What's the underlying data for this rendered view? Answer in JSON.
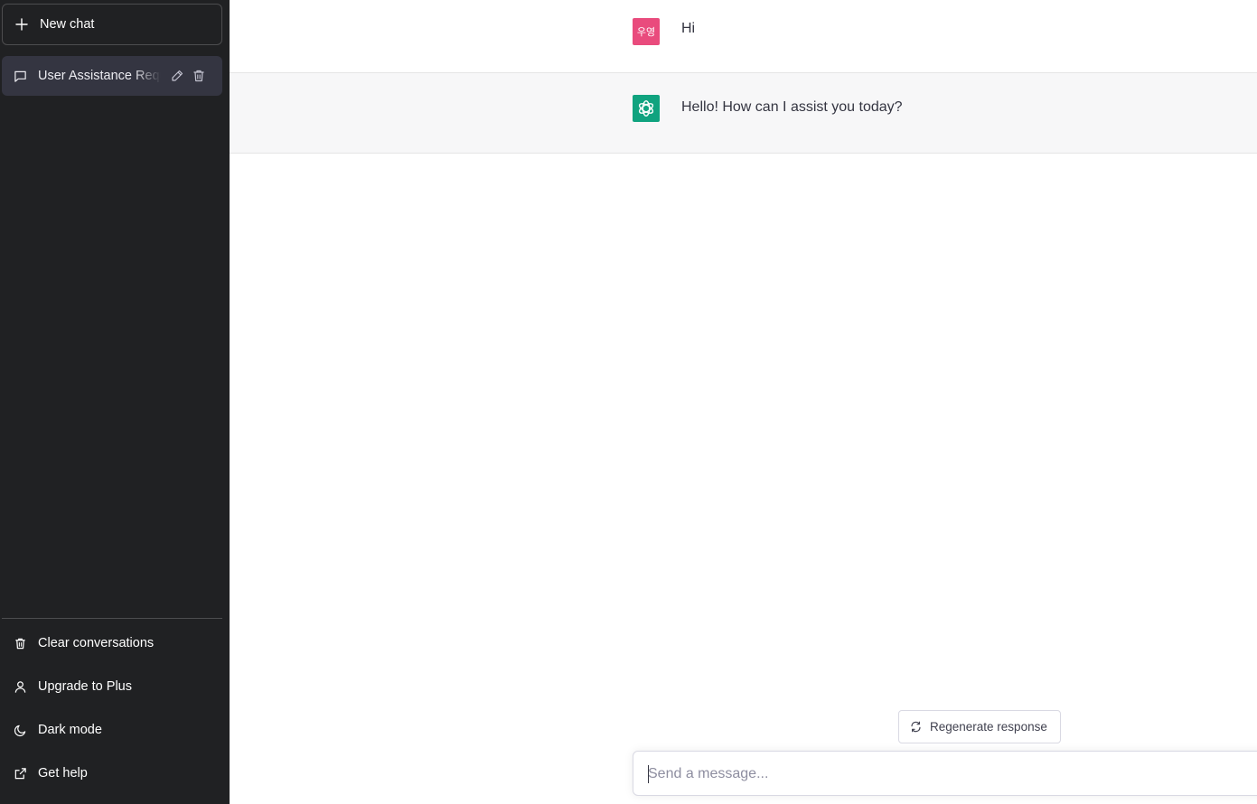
{
  "sidebar": {
    "new_chat_label": "New chat",
    "conversations": [
      {
        "title": "User Assistance Requ"
      }
    ],
    "menu": [
      {
        "label": "Clear conversations",
        "icon": "trash-icon"
      },
      {
        "label": "Upgrade to Plus",
        "icon": "user-icon"
      },
      {
        "label": "Dark mode",
        "icon": "moon-icon"
      },
      {
        "label": "Get help",
        "icon": "external-link-icon"
      }
    ]
  },
  "chat": {
    "messages": [
      {
        "role": "user",
        "avatar_text": "우영",
        "text": "Hi"
      },
      {
        "role": "assistant",
        "avatar_icon": "openai-logo-icon",
        "text": "Hello! How can I assist you today?"
      }
    ],
    "regenerate_label": "Regenerate response",
    "input_placeholder": "Send a message..."
  },
  "colors": {
    "sidebar_bg": "#202123",
    "active_item_bg": "#343541",
    "user_avatar": "#e94b7d",
    "assistant_avatar": "#10a37f",
    "assistant_row_bg": "#f7f7f8"
  }
}
